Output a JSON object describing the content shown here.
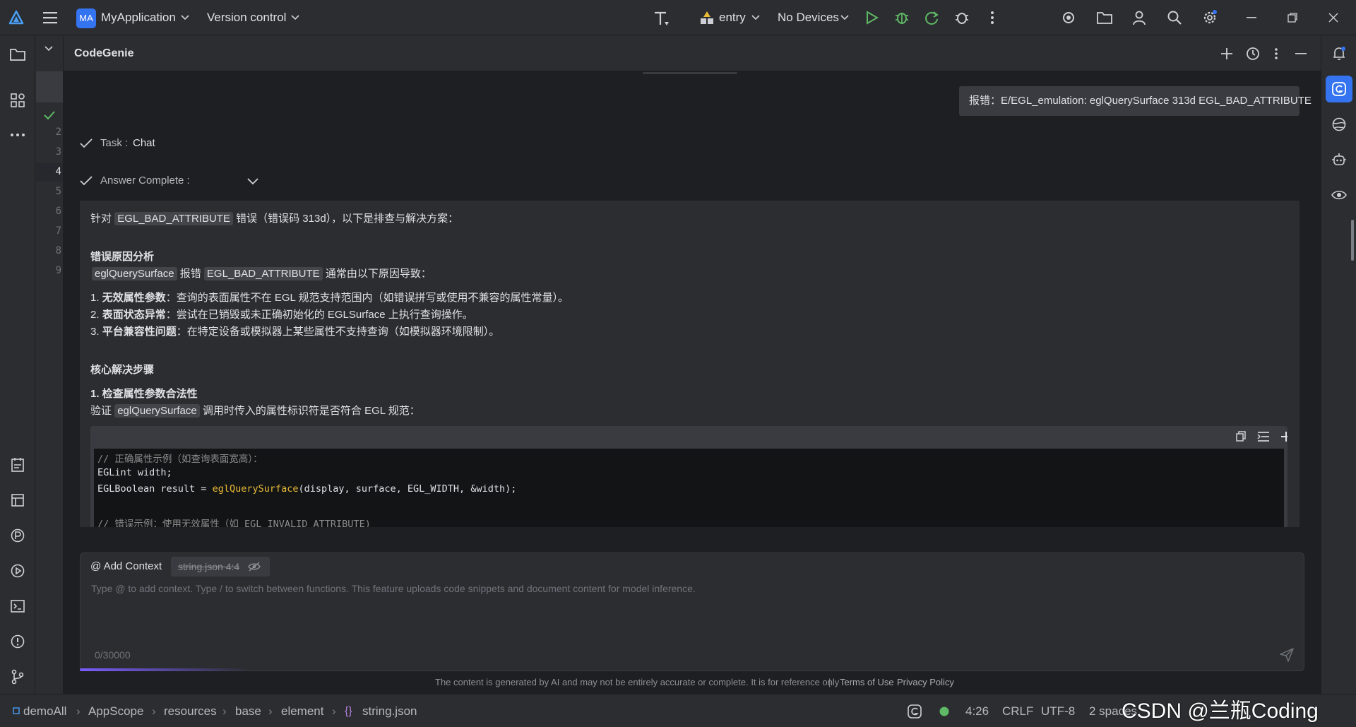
{
  "titlebar": {
    "app_badge": "MA",
    "project_name": "MyApplication",
    "vcs_label": "Version control",
    "module": "entry",
    "device": "No Devices"
  },
  "gutter": {
    "lines": [
      "2",
      "3",
      "4",
      "5",
      "6",
      "7",
      "8",
      "9"
    ]
  },
  "panel": {
    "title": "CodeGenie",
    "user_message": "报错：E/EGL_emulation: eglQuerySurface 313d EGL_BAD_ATTRIBUTE",
    "task_label": "Task :",
    "task_value": "Chat",
    "answer_label": "Answer Complete :"
  },
  "answer": {
    "intro_prefix": "针对",
    "intro_code": "EGL_BAD_ATTRIBUTE",
    "intro_suffix": "错误（错误码 313d），以下是排查与解决方案：",
    "sec1_title": "错误原因分析",
    "sec1_code1": "eglQuerySurface",
    "sec1_mid": "报错",
    "sec1_code2": "EGL_BAD_ATTRIBUTE",
    "sec1_suffix": "通常由以下原因导致：",
    "items": [
      {
        "num": "1.",
        "bold": "无效属性参数",
        "text": "：查询的表面属性不在 EGL 规范支持范围内（如错误拼写或使用不兼容的属性常量）。"
      },
      {
        "num": "2.",
        "bold": "表面状态异常",
        "text": "：尝试在已销毁或未正确初始化的 EGLSurface 上执行查询操作。"
      },
      {
        "num": "3.",
        "bold": "平台兼容性问题",
        "text": "：在特定设备或模拟器上某些属性不支持查询（如模拟器环境限制）。"
      }
    ],
    "sec2_title": "核心解决步骤",
    "step1_title": "1. 检查属性参数合法性",
    "step1_prefix": "验证",
    "step1_code": "eglQuerySurface",
    "step1_suffix": "调用时传入的属性标识符是否符合 EGL 规范：",
    "code": {
      "line1": "// 正确属性示例（如查询表面宽高）：",
      "line2": "EGLint width;",
      "line3_a": "EGLBoolean result = ",
      "line3_fn": "eglQuerySurface",
      "line3_b": "(display, surface, EGL_WIDTH, &width);",
      "line5": "// 错误示例：使用无效属性（如 EGL_INVALID_ATTRIBUTE)"
    }
  },
  "input": {
    "add_context": "@ Add Context",
    "file_chip": "string.json 4:4",
    "placeholder": "Type @ to add context. Type / to switch between functions. This feature uploads code snippets and document content for model inference.",
    "counter": "0/30000"
  },
  "footer": {
    "disclaimer": "The content is generated by AI and may not be entirely accurate or complete. It is for reference only",
    "separator": "|",
    "terms": "Terms of Use",
    "privacy": "Privacy Policy"
  },
  "statusbar": {
    "breadcrumbs": [
      "demoAll",
      "AppScope",
      "resources",
      "base",
      "element",
      "string.json"
    ],
    "position": "4:26",
    "line_sep": "CRLF",
    "encoding": "UTF-8",
    "indent": "2 spaces",
    "watermark": "CSDN @兰瓶Coding"
  },
  "colors": {
    "accent": "#3574f0",
    "run_green": "#5fb865",
    "function_yellow": "#e8ba36",
    "comment_gray": "#8c8c8c"
  }
}
